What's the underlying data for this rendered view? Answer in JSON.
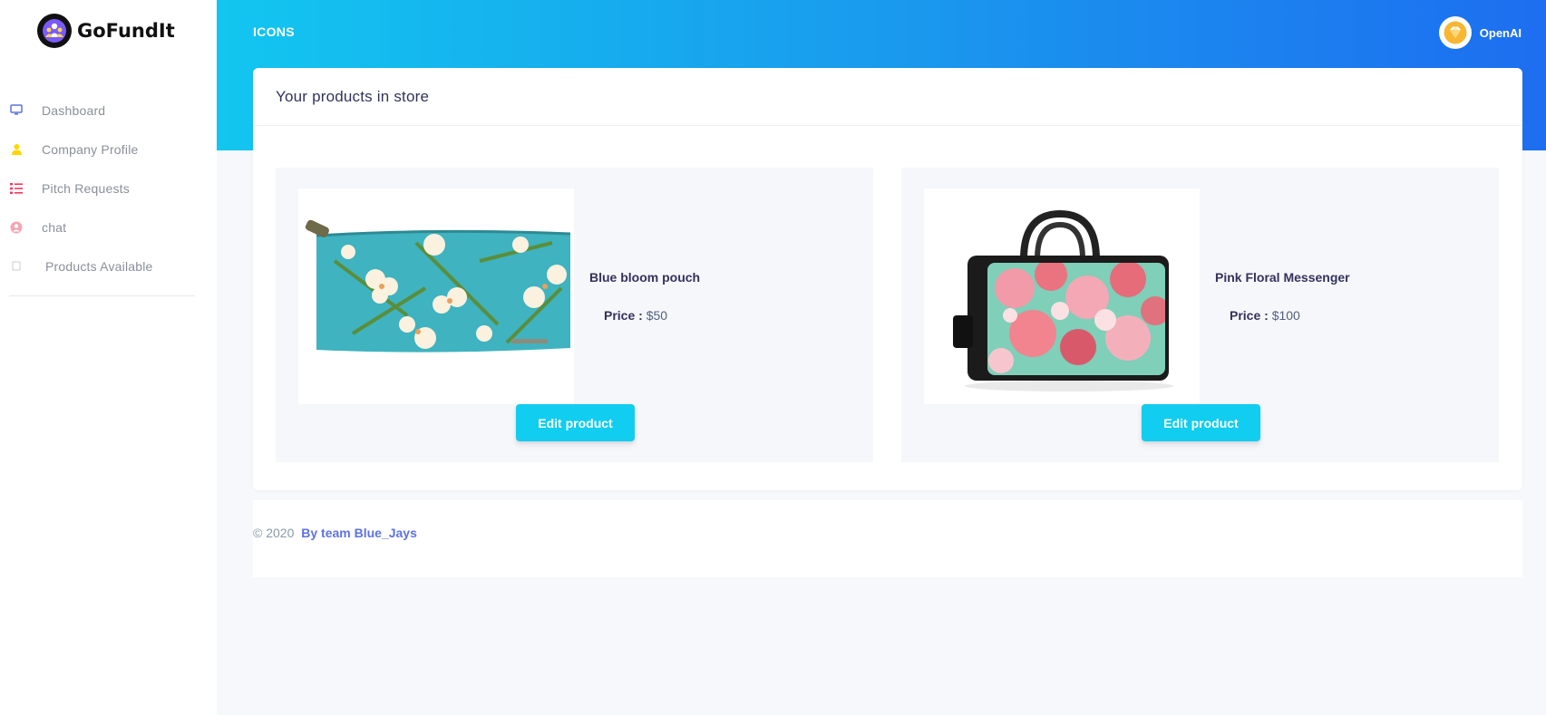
{
  "brand": {
    "name": "GoFundIt",
    "logo_icon": "users-group-icon"
  },
  "sidebar": {
    "items": [
      {
        "label": "Dashboard",
        "icon": "monitor-icon",
        "color": "#5e72e4"
      },
      {
        "label": "Company Profile",
        "icon": "user-icon",
        "color": "#ffd600"
      },
      {
        "label": "Pitch Requests",
        "icon": "list-icon",
        "color": "#f5365c"
      },
      {
        "label": "chat",
        "icon": "user-circle-icon",
        "color": "#f3a4b5"
      },
      {
        "label": "Products Available",
        "icon": "box-icon",
        "color": "#c8ccd4"
      }
    ]
  },
  "header": {
    "title": "ICONS",
    "user_name": "OpenAI",
    "gradient": [
      "#12c6ef",
      "#1d6ef0"
    ]
  },
  "card": {
    "title": "Your products in store"
  },
  "products": [
    {
      "name": "Blue bloom pouch",
      "price_label": "Price :",
      "price": "$50",
      "edit_label": "Edit product"
    },
    {
      "name": "Pink Floral Messenger",
      "price_label": "Price :",
      "price": "$100",
      "edit_label": "Edit product"
    }
  ],
  "footer": {
    "copyright": "© 2020",
    "link": "By team Blue_Jays"
  },
  "colors": {
    "accent": "#11cdef",
    "link": "#5e72e4",
    "background": "#f7f8fc"
  }
}
